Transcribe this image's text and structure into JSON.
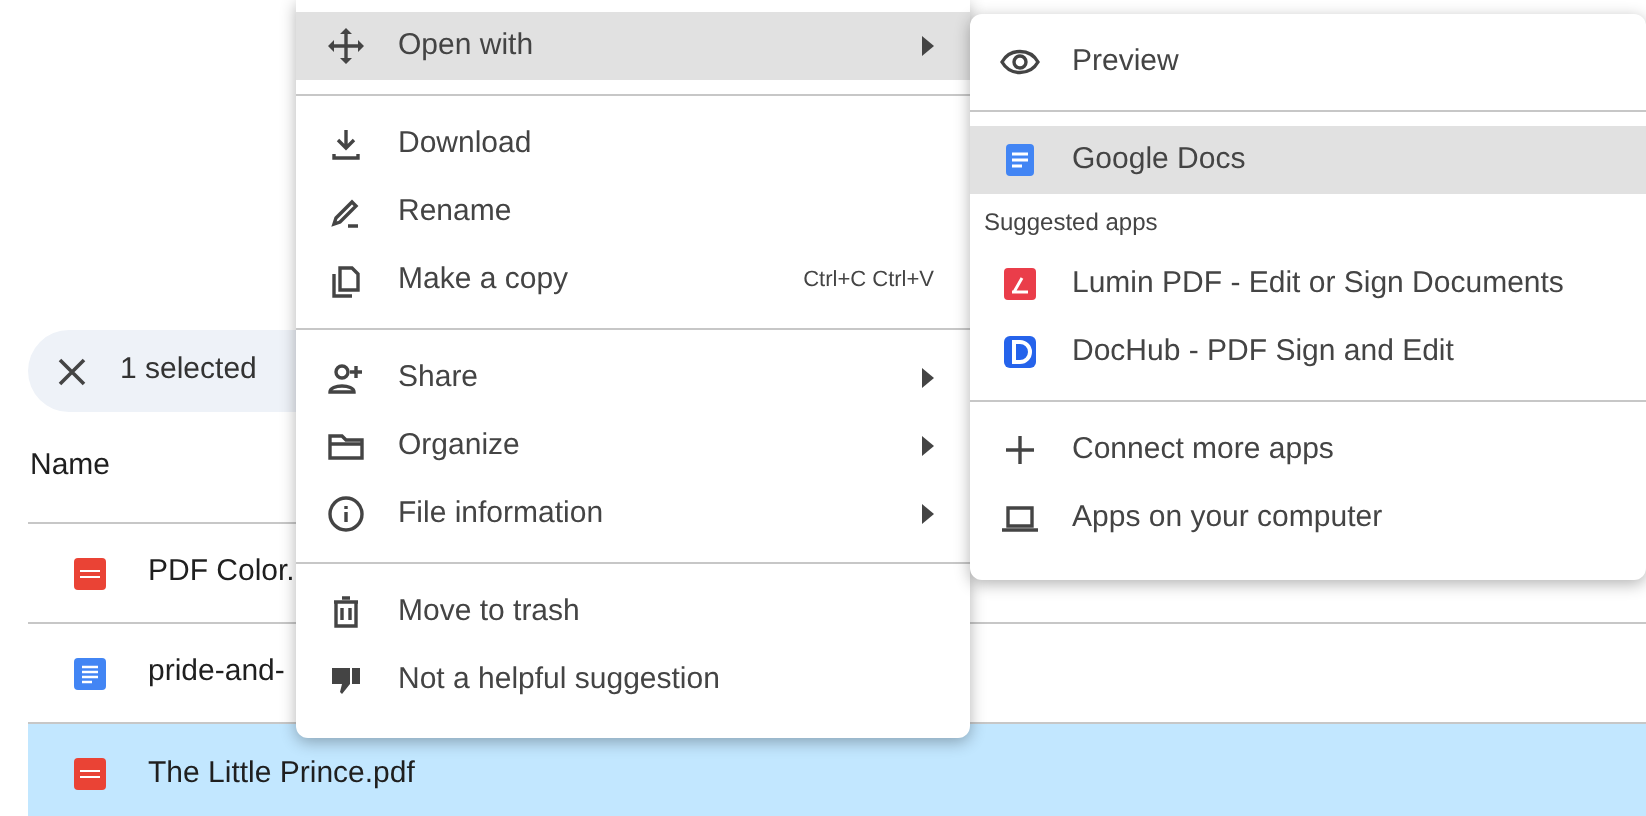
{
  "selection_bar": {
    "label": "1 selected"
  },
  "file_list": {
    "columns": [
      "Name"
    ],
    "rows": [
      {
        "name": "PDF Color.",
        "kind": "pdf",
        "selected": false
      },
      {
        "name": "pride-and-",
        "kind": "doc",
        "selected": false
      },
      {
        "name": "The Little Prince.pdf",
        "kind": "pdf",
        "selected": true
      }
    ]
  },
  "context_menu": {
    "groups": [
      [
        {
          "label": "Open with",
          "submenu": true,
          "highlighted": true
        }
      ],
      [
        {
          "label": "Download",
          "submenu": false,
          "highlighted": false
        },
        {
          "label": "Rename",
          "submenu": false,
          "highlighted": false
        },
        {
          "label": "Make a copy",
          "submenu": false,
          "highlighted": false,
          "shortcut": "Ctrl+C Ctrl+V"
        }
      ],
      [
        {
          "label": "Share",
          "submenu": true,
          "highlighted": false
        },
        {
          "label": "Organize",
          "submenu": true,
          "highlighted": false
        },
        {
          "label": "File information",
          "submenu": true,
          "highlighted": false
        }
      ],
      [
        {
          "label": "Move to trash",
          "submenu": false,
          "highlighted": false
        },
        {
          "label": "Not a helpful suggestion",
          "submenu": false,
          "highlighted": false
        }
      ]
    ]
  },
  "open_with_submenu": {
    "groups": [
      [
        {
          "kind": "item",
          "label": "Preview",
          "highlighted": false
        }
      ],
      [
        {
          "kind": "item",
          "label": "Google Docs",
          "highlighted": true
        },
        {
          "kind": "heading",
          "label": "Suggested apps"
        },
        {
          "kind": "item",
          "label": "Lumin PDF - Edit or Sign Documents",
          "highlighted": false
        },
        {
          "kind": "item",
          "label": "DocHub - PDF Sign and Edit",
          "highlighted": false
        }
      ],
      [
        {
          "kind": "item",
          "label": "Connect more apps",
          "highlighted": false
        },
        {
          "kind": "item",
          "label": "Apps on your computer",
          "highlighted": false
        }
      ]
    ]
  }
}
